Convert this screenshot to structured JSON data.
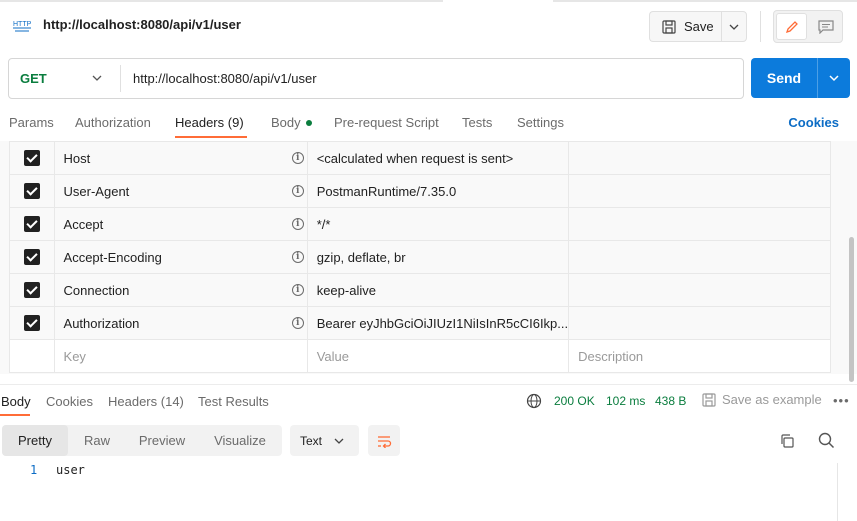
{
  "request": {
    "title": "http://localhost:8080/api/v1/user",
    "save_label": "Save",
    "method": "GET",
    "url": "http://localhost:8080/api/v1/user",
    "send_label": "Send"
  },
  "request_tabs": {
    "params": "Params",
    "authorization": "Authorization",
    "headers": "Headers",
    "headers_count": "(9)",
    "body": "Body",
    "pre_request": "Pre-request Script",
    "tests": "Tests",
    "settings": "Settings",
    "cookies": "Cookies"
  },
  "headers": [
    {
      "key": "Host",
      "value": "<calculated when request is sent>",
      "checked": true
    },
    {
      "key": "User-Agent",
      "value": "PostmanRuntime/7.35.0",
      "checked": true
    },
    {
      "key": "Accept",
      "value": "*/*",
      "checked": true
    },
    {
      "key": "Accept-Encoding",
      "value": "gzip, deflate, br",
      "checked": true
    },
    {
      "key": "Connection",
      "value": "keep-alive",
      "checked": true
    },
    {
      "key": "Authorization",
      "value": "Bearer eyJhbGciOiJIUzI1NiIsInR5cCI6Ikp...",
      "checked": true
    }
  ],
  "header_placeholders": {
    "key": "Key",
    "value": "Value",
    "description": "Description"
  },
  "response_tabs": {
    "body": "Body",
    "cookies": "Cookies",
    "headers": "Headers",
    "headers_count": "(14)",
    "test_results": "Test Results"
  },
  "response_status": {
    "status": "200 OK",
    "time": "102 ms",
    "size": "438 B",
    "save_example": "Save as example"
  },
  "response_view": {
    "pretty": "Pretty",
    "raw": "Raw",
    "preview": "Preview",
    "visualize": "Visualize",
    "format": "Text"
  },
  "response_body": {
    "line_number": "1",
    "content": "user"
  },
  "colors": {
    "accent": "#ff6c37",
    "send": "#0c7bdc",
    "method_get": "#0a7d3e",
    "status_ok": "#0a7d3e"
  }
}
